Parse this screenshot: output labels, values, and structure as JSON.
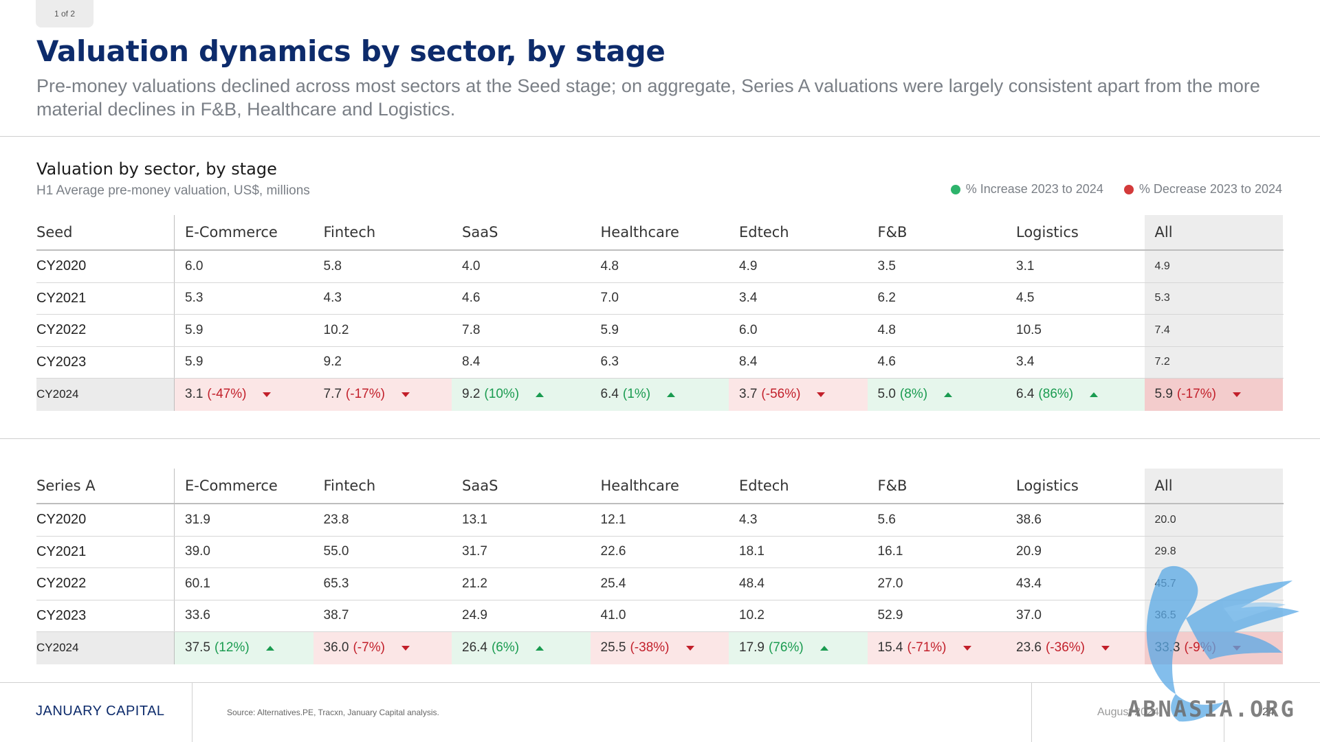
{
  "page_indicator": "1 of 2",
  "title": "Valuation dynamics by sector, by stage",
  "subtitle": "Pre-money valuations declined across most sectors at the Seed stage; on aggregate, Series A valuations were largely consistent apart from the more material declines in F&B, Healthcare and Logistics.",
  "section": {
    "title": "Valuation by sector, by stage",
    "subtitle": "H1 Average pre-money valuation, US$, millions"
  },
  "legend": {
    "increase": "% Increase 2023 to 2024",
    "decrease": "% Decrease 2023 to 2024",
    "increase_color": "#2db36b",
    "decrease_color": "#d33a3a"
  },
  "seed": {
    "stage": "Seed",
    "columns": [
      "E-Commerce",
      "Fintech",
      "SaaS",
      "Healthcare",
      "Edtech",
      "F&B",
      "Logistics",
      "All"
    ],
    "rows": [
      {
        "year": "CY2020",
        "values": [
          "6.0",
          "5.8",
          "4.0",
          "4.8",
          "4.9",
          "3.5",
          "3.1",
          "4.9"
        ]
      },
      {
        "year": "CY2021",
        "values": [
          "5.3",
          "4.3",
          "4.6",
          "7.0",
          "3.4",
          "6.2",
          "4.5",
          "5.3"
        ]
      },
      {
        "year": "CY2022",
        "values": [
          "5.9",
          "10.2",
          "7.8",
          "5.9",
          "6.0",
          "4.8",
          "10.5",
          "7.4"
        ]
      },
      {
        "year": "CY2023",
        "values": [
          "5.9",
          "9.2",
          "8.4",
          "6.3",
          "8.4",
          "4.6",
          "3.4",
          "7.2"
        ]
      }
    ],
    "final": {
      "year": "CY2024",
      "values": [
        {
          "value": "3.1",
          "pct": "(-47%)",
          "dir": "down"
        },
        {
          "value": "7.7",
          "pct": "(-17%)",
          "dir": "down"
        },
        {
          "value": "9.2",
          "pct": "(10%)",
          "dir": "up"
        },
        {
          "value": "6.4",
          "pct": "(1%)",
          "dir": "up"
        },
        {
          "value": "3.7",
          "pct": "(-56%)",
          "dir": "down"
        },
        {
          "value": "5.0",
          "pct": "(8%)",
          "dir": "up"
        },
        {
          "value": "6.4",
          "pct": "(86%)",
          "dir": "up"
        },
        {
          "value": "5.9",
          "pct": "(-17%)",
          "dir": "down"
        }
      ]
    }
  },
  "series_a": {
    "stage": "Series A",
    "columns": [
      "E-Commerce",
      "Fintech",
      "SaaS",
      "Healthcare",
      "Edtech",
      "F&B",
      "Logistics",
      "All"
    ],
    "rows": [
      {
        "year": "CY2020",
        "values": [
          "31.9",
          "23.8",
          "13.1",
          "12.1",
          "4.3",
          "5.6",
          "38.6",
          "20.0"
        ]
      },
      {
        "year": "CY2021",
        "values": [
          "39.0",
          "55.0",
          "31.7",
          "22.6",
          "18.1",
          "16.1",
          "20.9",
          "29.8"
        ]
      },
      {
        "year": "CY2022",
        "values": [
          "60.1",
          "65.3",
          "21.2",
          "25.4",
          "48.4",
          "27.0",
          "43.4",
          "45.7"
        ]
      },
      {
        "year": "CY2023",
        "values": [
          "33.6",
          "38.7",
          "24.9",
          "41.0",
          "10.2",
          "52.9",
          "37.0",
          "36.5"
        ]
      }
    ],
    "final": {
      "year": "CY2024",
      "values": [
        {
          "value": "37.5",
          "pct": "(12%)",
          "dir": "up"
        },
        {
          "value": "36.0",
          "pct": "(-7%)",
          "dir": "down"
        },
        {
          "value": "26.4",
          "pct": "(6%)",
          "dir": "up"
        },
        {
          "value": "25.5",
          "pct": "(-38%)",
          "dir": "down"
        },
        {
          "value": "17.9",
          "pct": "(76%)",
          "dir": "up"
        },
        {
          "value": "15.4",
          "pct": "(-71%)",
          "dir": "down"
        },
        {
          "value": "23.6",
          "pct": "(-36%)",
          "dir": "down"
        },
        {
          "value": "33.3",
          "pct": "(-9%)",
          "dir": "down"
        }
      ]
    }
  },
  "footer": {
    "brand": "JANUARY CAPITAL",
    "source": "Source: Alternatives.PE, Tracxn, January Capital analysis.",
    "date": "August 2024",
    "page": "24"
  },
  "watermark_text": "ABNASIA.ORG"
}
